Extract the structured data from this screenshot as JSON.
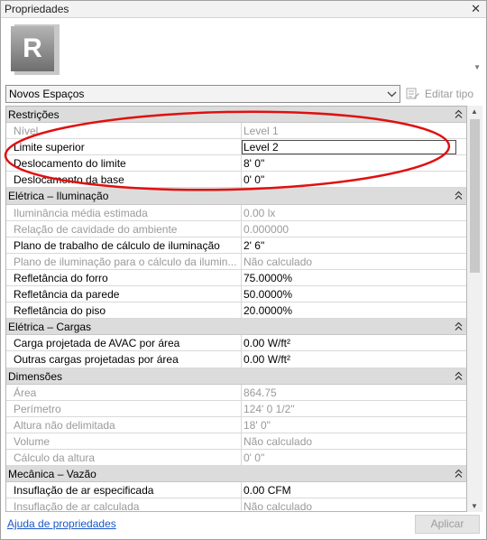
{
  "window": {
    "title": "Propriedades",
    "close_glyph": "✕"
  },
  "type_selector": {
    "logo_letter": "R",
    "selected": "Novos Espaços",
    "edit_type_label": "Editar tipo"
  },
  "groups": [
    {
      "title": "Restrições",
      "rows": [
        {
          "label": "Nível",
          "value": "Level 1",
          "readonly": true
        },
        {
          "label": "Limite superior",
          "value": "Level 2",
          "readonly": false,
          "editing": true
        },
        {
          "label": "Deslocamento do limite",
          "value": "8'  0\"",
          "readonly": false
        },
        {
          "label": "Deslocamento da base",
          "value": "0'  0\"",
          "readonly": false
        }
      ]
    },
    {
      "title": "Elétrica – Iluminação",
      "rows": [
        {
          "label": "Iluminância média estimada",
          "value": "0.00 lx",
          "readonly": true
        },
        {
          "label": "Relação de cavidade do ambiente",
          "value": "0.000000",
          "readonly": true
        },
        {
          "label": "Plano de trabalho de cálculo de iluminação",
          "value": "2'  6\"",
          "readonly": false
        },
        {
          "label": "Plano de iluminação para o cálculo da ilumin...",
          "value": "Não calculado",
          "readonly": true
        },
        {
          "label": "Refletância do forro",
          "value": "75.0000%",
          "readonly": false
        },
        {
          "label": "Refletância da parede",
          "value": "50.0000%",
          "readonly": false
        },
        {
          "label": "Refletância do piso",
          "value": "20.0000%",
          "readonly": false
        }
      ]
    },
    {
      "title": "Elétrica – Cargas",
      "rows": [
        {
          "label": "Carga projetada de AVAC por área",
          "value": "0.00 W/ft²",
          "readonly": false
        },
        {
          "label": "Outras cargas projetadas por área",
          "value": "0.00 W/ft²",
          "readonly": false
        }
      ]
    },
    {
      "title": "Dimensões",
      "rows": [
        {
          "label": "Área",
          "value": "864.75",
          "readonly": true
        },
        {
          "label": "Perímetro",
          "value": "124'  0 1/2\"",
          "readonly": true
        },
        {
          "label": "Altura não delimitada",
          "value": "18'  0\"",
          "readonly": true
        },
        {
          "label": "Volume",
          "value": "Não calculado",
          "readonly": true
        },
        {
          "label": "Cálculo da altura",
          "value": "0'  0\"",
          "readonly": true
        }
      ]
    },
    {
      "title": "Mecânica – Vazão",
      "rows": [
        {
          "label": "Insuflação de ar especificada",
          "value": "0.00 CFM",
          "readonly": false
        },
        {
          "label": "Insuflação de ar calculada",
          "value": "Não calculado",
          "readonly": true
        }
      ]
    }
  ],
  "footer": {
    "help_link": "Ajuda de propriedades",
    "apply_label": "Aplicar"
  },
  "colors": {
    "annotation": "#e01010",
    "category_bg": "#dcdcdc",
    "link": "#1a56c6"
  }
}
